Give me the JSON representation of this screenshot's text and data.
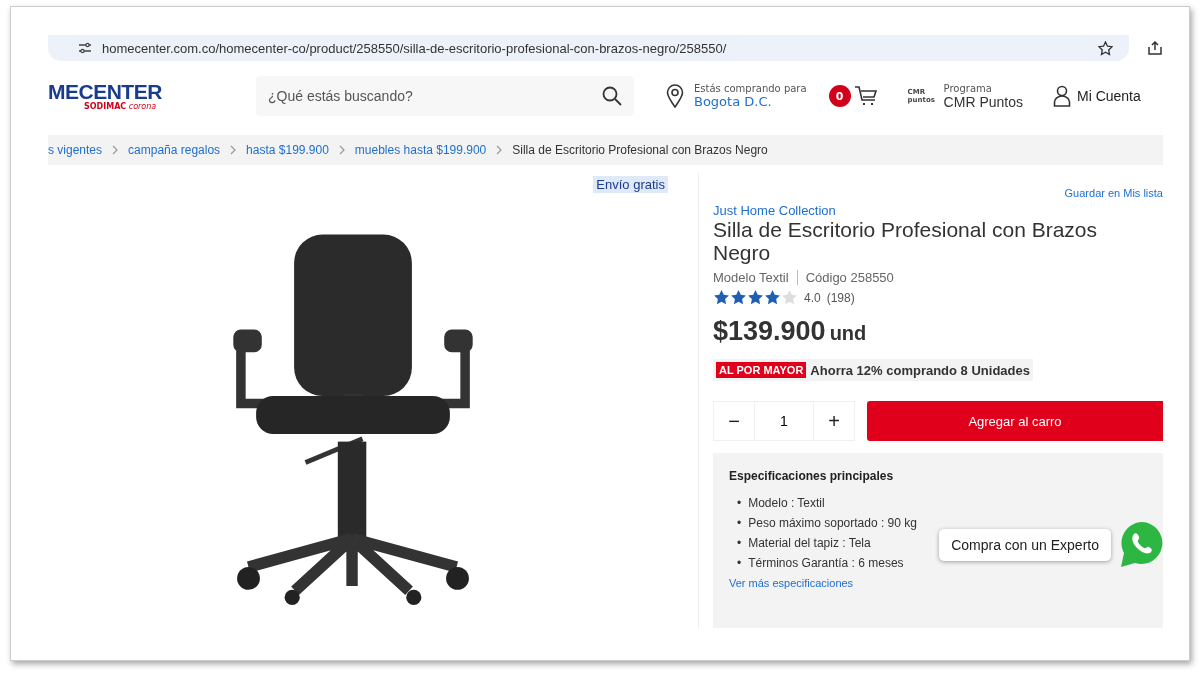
{
  "address_bar": {
    "url": "homecenter.com.co/homecenter-co/product/258550/silla-de-escritorio-profesional-con-brazos-negro/258550/"
  },
  "header": {
    "logo": {
      "name": "MECENTER",
      "sub_left": "SODIMAC",
      "sub_right": "corona"
    },
    "search": {
      "placeholder": "¿Qué estás buscando?"
    },
    "location": {
      "label": "Estás comprando para",
      "city": "Bogota D.C."
    },
    "cart_count": "0",
    "points": {
      "icon_text": "CMR puntos",
      "label": "Programa",
      "name": "CMR Puntos"
    },
    "account": "Mi Cuenta"
  },
  "breadcrumb": [
    {
      "label": "s vigentes",
      "selected": false
    },
    {
      "label": "campaña regalos",
      "selected": false
    },
    {
      "label": "hasta $199.900",
      "selected": false
    },
    {
      "label": "muebles hasta $199.900",
      "selected": false
    },
    {
      "label": "Silla de Escritorio Profesional con Brazos Negro",
      "selected": true
    }
  ],
  "gallery": {
    "badge": "Envío gratis"
  },
  "product": {
    "save_link": "Guardar en Mis lista",
    "brand": "Just Home Collection",
    "title": "Silla de Escritorio Profesional con Brazos Negro",
    "model": "Modelo Textil",
    "code": "Código 258550",
    "stars": 4,
    "rating": "4.0",
    "reviews": "(198)",
    "price": "$139.900",
    "unit": "und",
    "wholesale_tag": "AL POR MAYOR",
    "wholesale_text": "Ahorra 12% comprando 8 Unidades",
    "quantity": "1",
    "minus": "−",
    "plus": "+",
    "add_button": "Agregar al carro"
  },
  "specs": {
    "title": "Especificaciones principales",
    "bullet": "•",
    "items": [
      "Modelo : Textil",
      "Peso máximo soportado : 90 kg",
      "Material del tapiz : Tela",
      "Términos Garantía : 6 meses"
    ],
    "more_link": "Ver más especificaciones"
  },
  "chat": {
    "label": "Compra con un Experto"
  }
}
